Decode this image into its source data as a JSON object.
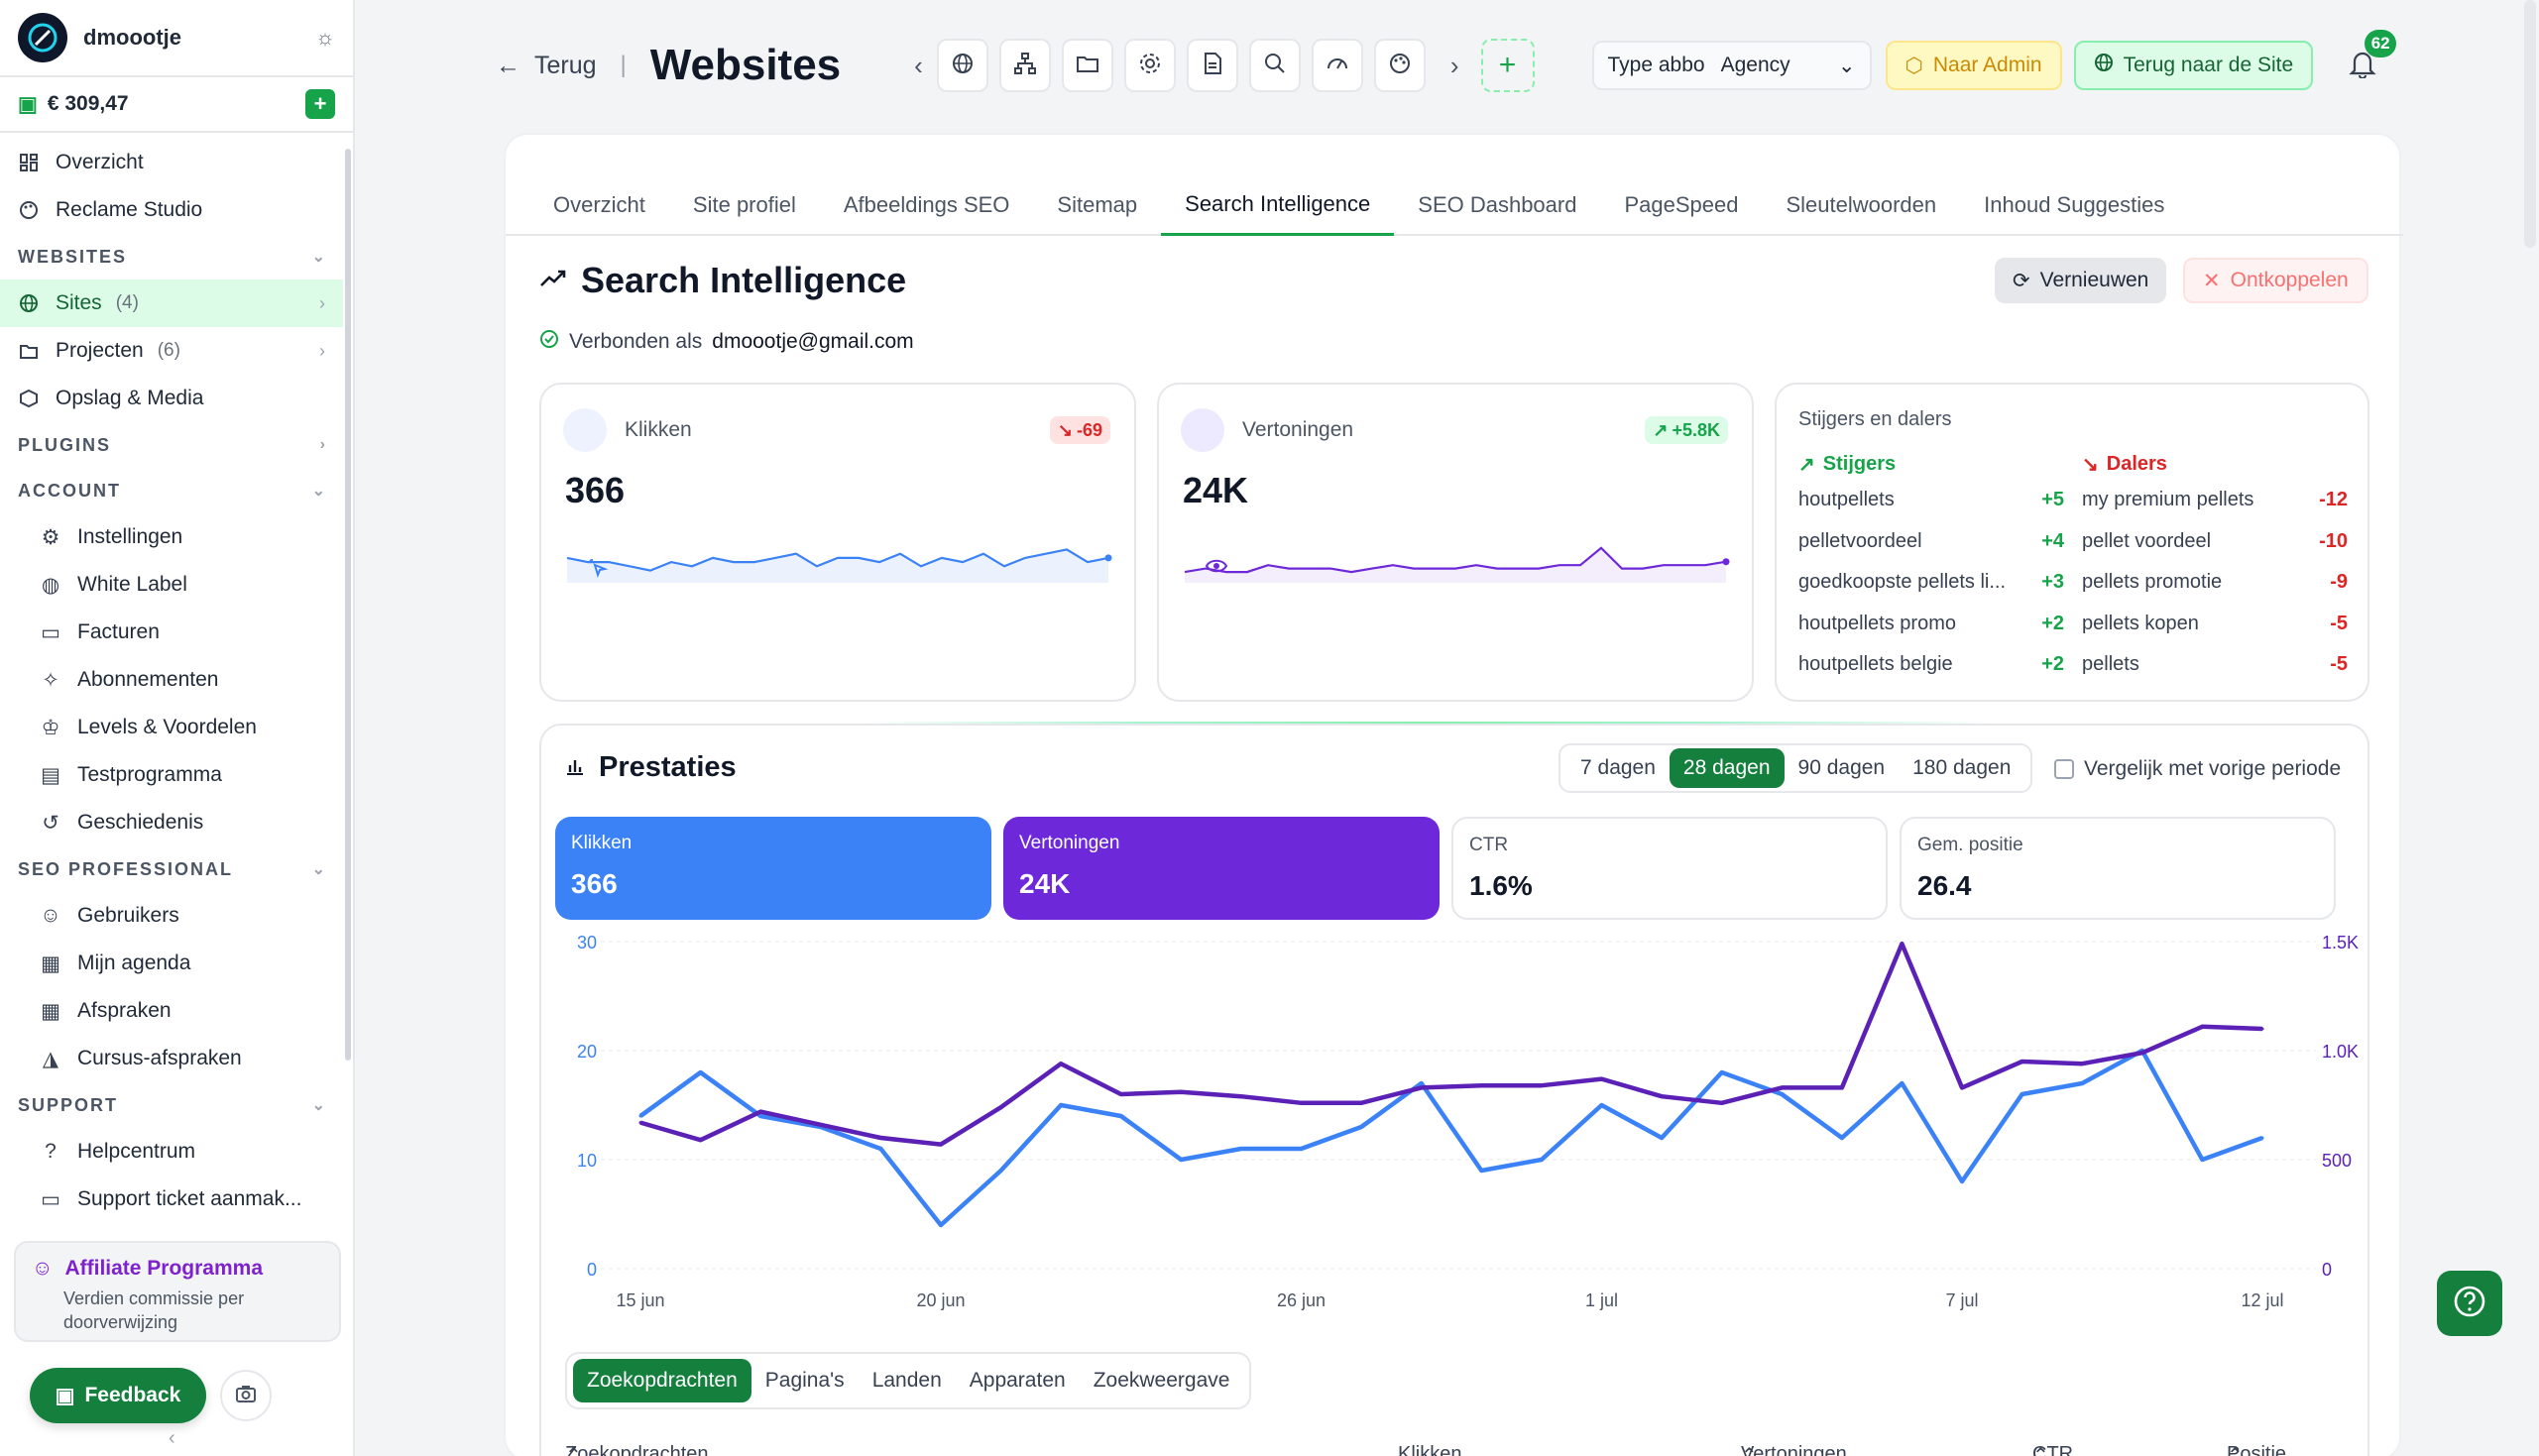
{
  "sidebar": {
    "username": "dmoootje",
    "balance": "€ 309,47",
    "items_top": [
      {
        "label": "Overzicht",
        "icon": "dashboard-icon"
      },
      {
        "label": "Reclame Studio",
        "icon": "palette-icon"
      }
    ],
    "sections": {
      "websites": "WEBSITES",
      "plugins": "PLUGINS",
      "account": "ACCOUNT",
      "seo_professional": "SEO PROFESSIONAL",
      "support": "SUPPORT"
    },
    "websites_items": [
      {
        "label": "Sites",
        "count": "(4)"
      },
      {
        "label": "Projecten",
        "count": "(6)"
      },
      {
        "label": "Opslag & Media",
        "count": ""
      }
    ],
    "account_items": [
      "Instellingen",
      "White Label",
      "Facturen",
      "Abonnementen",
      "Levels & Voordelen",
      "Testprogramma",
      "Geschiedenis"
    ],
    "seo_items": [
      "Gebruikers",
      "Mijn agenda",
      "Afspraken",
      "Cursus-afspraken"
    ],
    "support_items": [
      "Helpcentrum",
      "Support ticket aanmak..."
    ],
    "affiliate_title": "Affiliate Programma",
    "affiliate_sub": "Verdien commissie per doorverwijzing",
    "feedback": "Feedback"
  },
  "topbar": {
    "back": "Terug",
    "title": "Websites",
    "type_label": "Type abbo",
    "type_value": "Agency",
    "admin": "Naar Admin",
    "site": "Terug naar de Site",
    "notifications": "62"
  },
  "tabs": [
    "Overzicht",
    "Site profiel",
    "Afbeeldings SEO",
    "Sitemap",
    "Search Intelligence",
    "SEO Dashboard",
    "PageSpeed",
    "Sleutelwoorden",
    "Inhoud Suggesties"
  ],
  "active_tab": "Search Intelligence",
  "si": {
    "title": "Search Intelligence",
    "refresh": "Vernieuwen",
    "disconnect": "Ontkoppelen",
    "connected_label": "Verbonden als",
    "connected_email": "dmoootje@gmail.com"
  },
  "metrics": {
    "clicks": {
      "label": "Klikken",
      "value": "366",
      "delta": "-69",
      "spark": [
        12,
        11,
        11,
        10,
        9,
        11,
        10,
        12,
        11,
        11,
        12,
        13,
        10,
        12,
        12,
        11,
        13,
        10,
        12,
        11,
        13,
        10,
        12,
        13,
        14,
        11,
        12
      ]
    },
    "impressions": {
      "label": "Vertoningen",
      "value": "24K",
      "delta": "+5.8K",
      "spark": [
        10,
        11,
        10,
        10,
        12,
        11,
        11,
        11,
        10,
        11,
        12,
        11,
        11,
        11,
        12,
        11,
        11,
        11,
        12,
        12,
        17,
        11,
        11,
        12,
        12,
        12,
        13
      ]
    }
  },
  "movers": {
    "title": "Stijgers en dalers",
    "risers_label": "Stijgers",
    "fallers_label": "Dalers",
    "risers": [
      {
        "term": "houtpellets",
        "value": "+5"
      },
      {
        "term": "pelletvoordeel",
        "value": "+4"
      },
      {
        "term": "goedkoopste pellets li...",
        "value": "+3"
      },
      {
        "term": "houtpellets promo",
        "value": "+2"
      },
      {
        "term": "houtpellets belgie",
        "value": "+2"
      }
    ],
    "fallers": [
      {
        "term": "my premium pellets",
        "value": "-12"
      },
      {
        "term": "pellet voordeel",
        "value": "-10"
      },
      {
        "term": "pellets promotie",
        "value": "-9"
      },
      {
        "term": "pellets kopen",
        "value": "-5"
      },
      {
        "term": "pellets",
        "value": "-5"
      }
    ]
  },
  "performance": {
    "title": "Prestaties",
    "ranges": [
      "7 dagen",
      "28 dagen",
      "90 dagen",
      "180 dagen"
    ],
    "active_range": "28 dagen",
    "compare": "Vergelijk met vorige periode",
    "stats": [
      {
        "label": "Klikken",
        "value": "366"
      },
      {
        "label": "Vertoningen",
        "value": "24K"
      },
      {
        "label": "CTR",
        "value": "1.6%"
      },
      {
        "label": "Gem. positie",
        "value": "26.4"
      }
    ],
    "subtabs": [
      "Zoekopdrachten",
      "Pagina's",
      "Landen",
      "Apparaten",
      "Zoekweergave"
    ],
    "columns": [
      "Zoekopdrachten",
      "Klikken",
      "Vertoningen",
      "CTR",
      "Positie"
    ]
  },
  "chart_data": {
    "type": "line",
    "x": [
      "15 jun",
      "16 jun",
      "17 jun",
      "18 jun",
      "19 jun",
      "20 jun",
      "21 jun",
      "22 jun",
      "23 jun",
      "24 jun",
      "25 jun",
      "26 jun",
      "27 jun",
      "28 jun",
      "29 jun",
      "30 jun",
      "1 jul",
      "2 jul",
      "3 jul",
      "4 jul",
      "5 jul",
      "6 jul",
      "7 jul",
      "8 jul",
      "9 jul",
      "10 jul",
      "11 jul",
      "12 jul"
    ],
    "x_tick_labels": [
      "15 jun",
      "20 jun",
      "26 jun",
      "1 jul",
      "7 jul",
      "12 jul"
    ],
    "series": [
      {
        "name": "Klikken",
        "axis": "left",
        "color": "#3b82f6",
        "values": [
          14,
          18,
          14,
          13,
          11,
          4,
          9,
          15,
          14,
          10,
          11,
          11,
          13,
          17,
          9,
          10,
          15,
          12,
          18,
          16,
          12,
          17,
          8,
          16,
          17,
          20,
          10,
          12
        ]
      },
      {
        "name": "Vertoningen",
        "axis": "right",
        "color": "#5b21b6",
        "values": [
          670,
          590,
          720,
          660,
          600,
          570,
          740,
          940,
          800,
          810,
          790,
          760,
          760,
          830,
          840,
          840,
          870,
          790,
          760,
          830,
          830,
          1490,
          830,
          950,
          940,
          990,
          1110,
          1100
        ]
      }
    ],
    "ylim_left": [
      0,
      30
    ],
    "yticks_left": [
      "0",
      "10",
      "20",
      "30"
    ],
    "ylim_right": [
      0,
      1500
    ],
    "yticks_right": [
      "0",
      "500",
      "1.0K",
      "1.5K"
    ],
    "grid": true
  }
}
